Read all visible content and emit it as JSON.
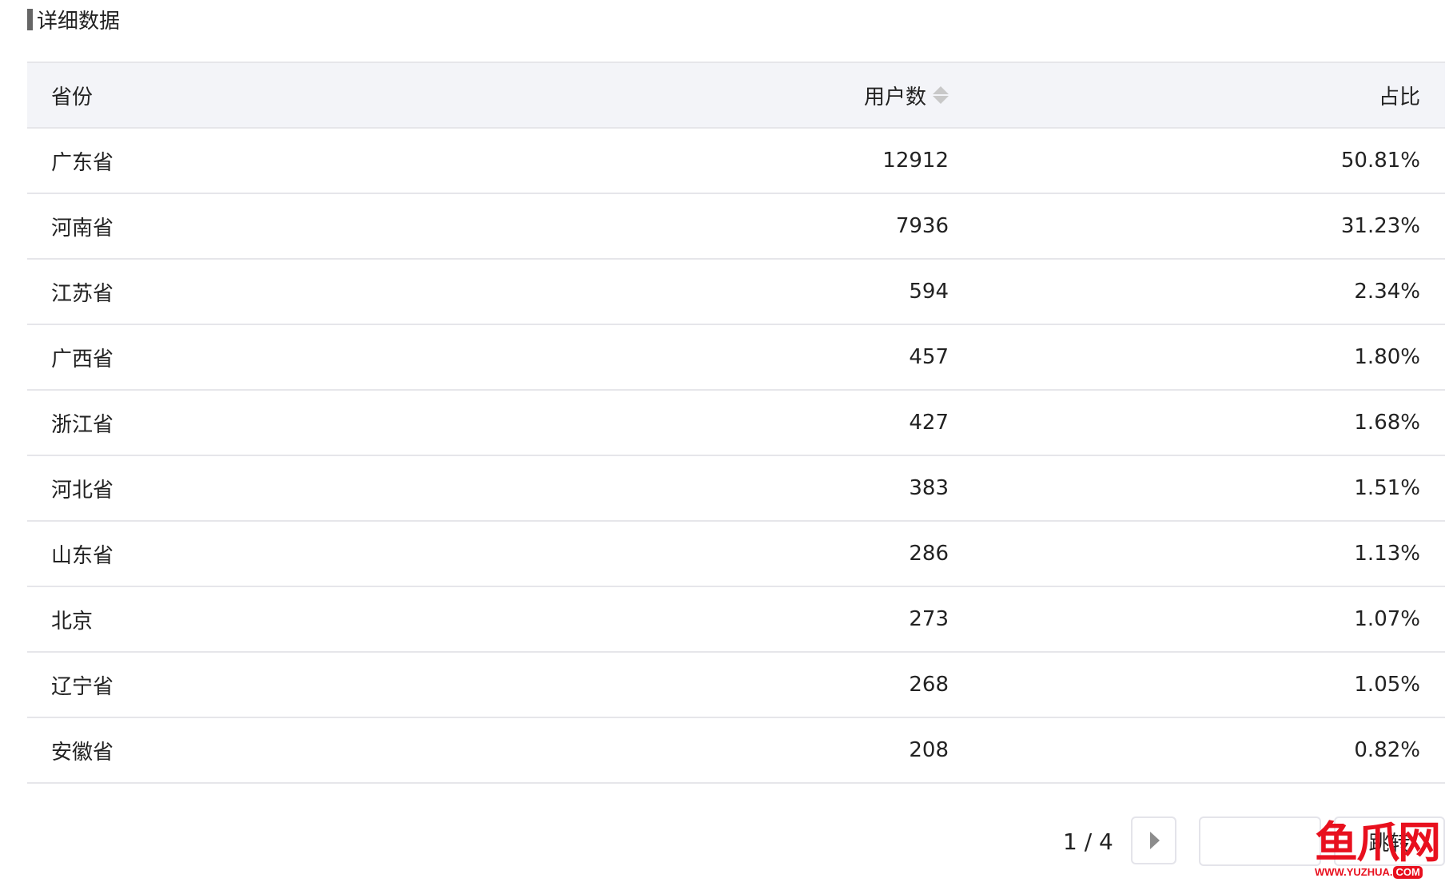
{
  "section": {
    "title": "详细数据",
    "accent_color": "#666666"
  },
  "table": {
    "columns": {
      "province": "省份",
      "users": "用户数",
      "ratio": "占比"
    },
    "sort_icon": "sort-icon",
    "rows": [
      {
        "province": "广东省",
        "users": "12912",
        "ratio": "50.81%"
      },
      {
        "province": "河南省",
        "users": "7936",
        "ratio": "31.23%"
      },
      {
        "province": "江苏省",
        "users": "594",
        "ratio": "2.34%"
      },
      {
        "province": "广西省",
        "users": "457",
        "ratio": "1.80%"
      },
      {
        "province": "浙江省",
        "users": "427",
        "ratio": "1.68%"
      },
      {
        "province": "河北省",
        "users": "383",
        "ratio": "1.51%"
      },
      {
        "province": "山东省",
        "users": "286",
        "ratio": "1.13%"
      },
      {
        "province": "北京",
        "users": "273",
        "ratio": "1.07%"
      },
      {
        "province": "辽宁省",
        "users": "268",
        "ratio": "1.05%"
      },
      {
        "province": "安徽省",
        "users": "208",
        "ratio": "0.82%"
      }
    ]
  },
  "pagination": {
    "page_info": "1 / 4",
    "next_icon": "caret-right-icon",
    "jump_input_value": "",
    "jump_label": "跳转"
  },
  "watermark": {
    "logo": "鱼爪网",
    "url_main": "WWW.YUZHUA.",
    "url_tld": "COM",
    "color": "#e8101e"
  }
}
